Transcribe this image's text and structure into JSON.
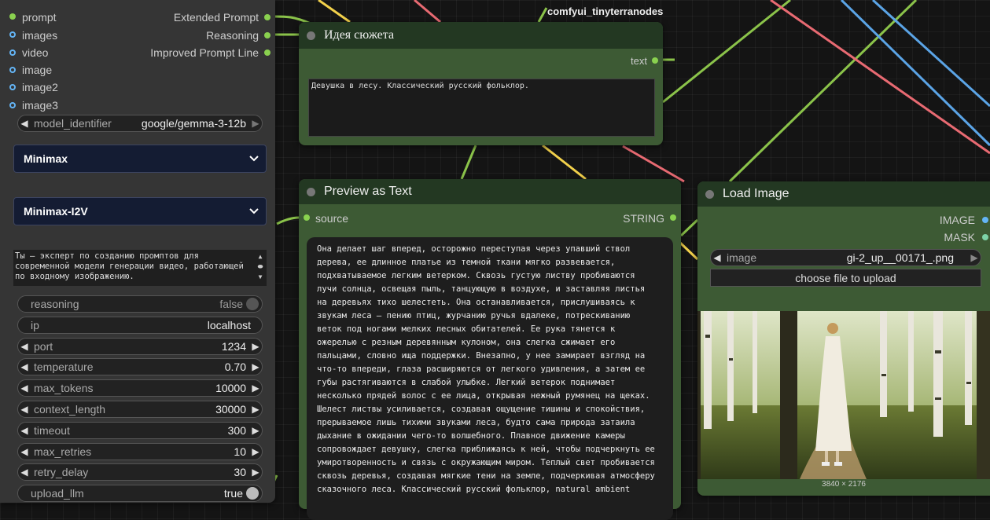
{
  "left_node": {
    "inputs": [
      "prompt",
      "images",
      "video",
      "image",
      "image2",
      "image3"
    ],
    "outputs": [
      "Extended Prompt",
      "Reasoning",
      "Improved Prompt Line"
    ],
    "model_identifier": {
      "name": "model_identifier",
      "value": "google/gemma-3-12b"
    },
    "select_provider": "Minimax",
    "select_model": "Minimax-I2V",
    "system_prompt": "Ты — эксперт по созданию промптов для современной модели генерации видео, работающей по входному изображению.",
    "widgets": [
      {
        "name": "reasoning",
        "value": "false"
      },
      {
        "name": "ip",
        "value": "localhost"
      },
      {
        "name": "port",
        "value": "1234"
      },
      {
        "name": "temperature",
        "value": "0.70"
      },
      {
        "name": "max_tokens",
        "value": "10000"
      },
      {
        "name": "context_length",
        "value": "30000"
      },
      {
        "name": "timeout",
        "value": "300"
      },
      {
        "name": "max_retries",
        "value": "10"
      },
      {
        "name": "retry_delay",
        "value": "30"
      },
      {
        "name": "upload_llm",
        "value": "true"
      }
    ]
  },
  "top_label": "comfyui_tinyterranodes",
  "idea_node": {
    "title": "Идея сюжета",
    "output": "text",
    "text": "Девушка в лесу. Классический русский фольклор."
  },
  "preview_node": {
    "title": "Preview as Text",
    "input": "source",
    "output": "STRING",
    "text": "Она делает шаг вперед, осторожно переступая через упавший ствол\nдерева, ее длинное платье из темной ткани мягко развевается,\nподхватываемое легким ветерком. Сквозь густую листву пробиваются\nлучи солнца, освещая пыль, танцующую в воздухе, и заставляя листья\nна деревьях тихо шелестеть. Она останавливается, прислушиваясь к\nзвукам леса — пению птиц, журчанию ручья вдалеке, потрескиванию\nветок под ногами мелких лесных обитателей. Ее рука тянется к\nожерелью с резным деревянным кулоном, она слегка сжимает его\nпальцами, словно ища поддержки. Внезапно, у нее замирает взгляд на\nчто-то впереди, глаза расширяются от легкого удивления, а затем ее\nгубы растягиваются в слабой улыбке. Легкий ветерок поднимает\nнесколько прядей волос с ее лица, открывая нежный румянец на щеках.\nШелест листвы усиливается, создавая ощущение тишины и спокойствия,\nпрерываемое лишь тихими звуками леса, будто сама природа затаила\nдыхание в ожидании чего-то волшебного. Плавное движение камеры\nсопровождает девушку, слегка приближаясь к ней, чтобы подчеркнуть ее\nумиротворенность и связь с окружающим миром. Теплый свет пробивается\nсквозь деревья, создавая мягкие тени на земле, подчеркивая атмосферу\nсказочного леса. Классический русский фольклор, natural ambient"
  },
  "load_node": {
    "title": "Load Image",
    "outputs": [
      "IMAGE",
      "MASK"
    ],
    "image_widget": {
      "name": "image",
      "value": "gi-2_up__00171_.png"
    },
    "upload_label": "choose file to upload",
    "dims": "3840 × 2176"
  },
  "colors": {
    "wire_green": "#8bc34a",
    "wire_yellow": "#f2d14b",
    "wire_red": "#e86a72",
    "wire_blue": "#5ba4e6",
    "node_green": "#3d5a34",
    "node_header_green": "#233822",
    "slot_green": "#8ad14f",
    "slot_blue": "#64b5f6"
  }
}
